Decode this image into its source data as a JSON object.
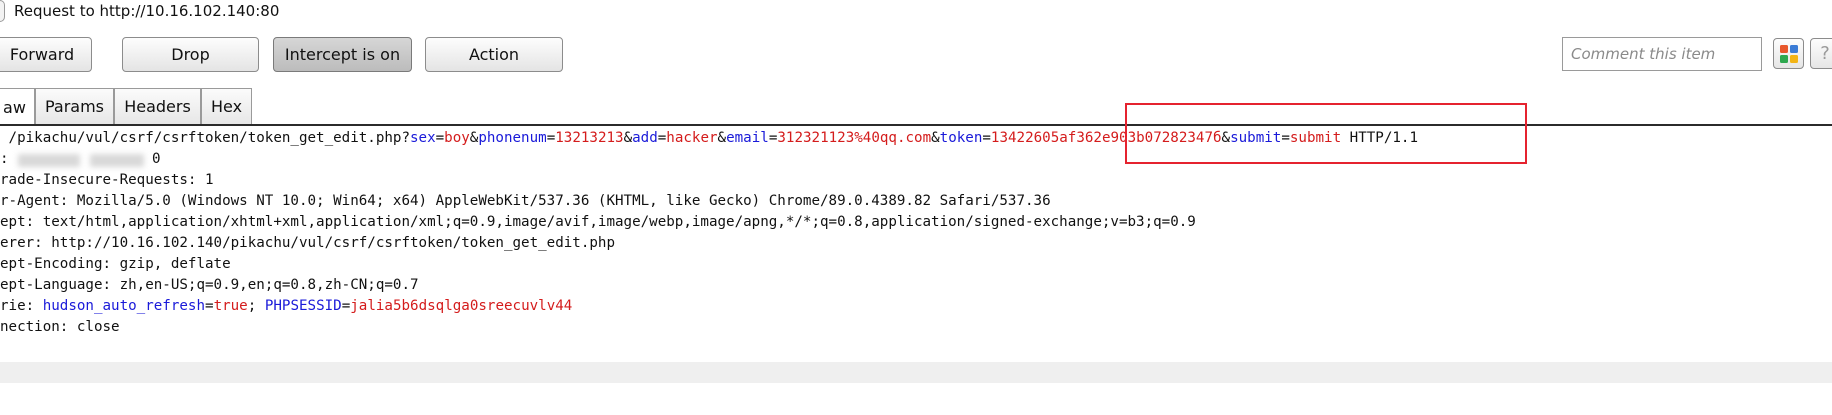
{
  "request": {
    "title": "Request to http://10.16.102.140:80"
  },
  "toolbar": {
    "forward_label": "Forward",
    "drop_label": "Drop",
    "intercept_label": "Intercept is on",
    "action_label": "Action",
    "comment_placeholder": "Comment this item",
    "help_label": "?"
  },
  "tabs": [
    {
      "label": "aw",
      "active": true
    },
    {
      "label": "Params",
      "active": false
    },
    {
      "label": "Headers",
      "active": false
    },
    {
      "label": "Hex",
      "active": false
    }
  ],
  "request_line": {
    "path": " /pikachu/vul/csrf/csrftoken/token_get_edit.php?",
    "params": [
      {
        "key": "sex",
        "value": "boy"
      },
      {
        "key": "phonenum",
        "value": "13213213"
      },
      {
        "key": "add",
        "value": "hacker"
      },
      {
        "key": "email",
        "value": "312321123%40qq.com"
      },
      {
        "key": "token",
        "value": "13422605af362e903b07282347б"
      },
      {
        "key": "submit",
        "value": "submit"
      }
    ],
    "eq": "=",
    "amp": "&",
    "protocol": " HTTP/1.1"
  },
  "headers": [
    {
      "text": ":"
    },
    {
      "text": "rade-Insecure-Requests: 1"
    },
    {
      "text": "r-Agent: Mozilla/5.0 (Windows NT 10.0; Win64; x64) AppleWebKit/537.36 (KHTML, like Gecko) Chrome/89.0.4389.82 Safari/537.36"
    },
    {
      "text": "ept: text/html,application/xhtml+xml,application/xml;q=0.9,image/avif,image/webp,image/apng,*/*;q=0.8,application/signed-exchange;v=b3;q=0.9"
    },
    {
      "text": "erer: http://10.16.102.140/pikachu/vul/csrf/csrftoken/token_get_edit.php"
    },
    {
      "text": "ept-Encoding: gzip, deflate"
    },
    {
      "text": "ept-Language: zh,en-US;q=0.9,en;q=0.8,zh-CN;q=0.7"
    }
  ],
  "host_tail": "0",
  "cookie": {
    "prefix": "rie: ",
    "k1": "hudson_auto_refresh",
    "v1": "true",
    "sep": "; ",
    "k2": "PHPSESSID",
    "v2": "jalia5b6dsqlga0sreecuvlv44"
  },
  "connection": "nection: close",
  "colors": {
    "param_key": "#1a1ad9",
    "param_value": "#d41c1c",
    "highlight": "#e5232f",
    "grid_icon": [
      "#e8572b",
      "#3a7bd5",
      "#2ea84f",
      "#f2b416"
    ]
  },
  "icons": {
    "grid_icon": "colored-grid-icon",
    "help_icon": "help-icon"
  }
}
